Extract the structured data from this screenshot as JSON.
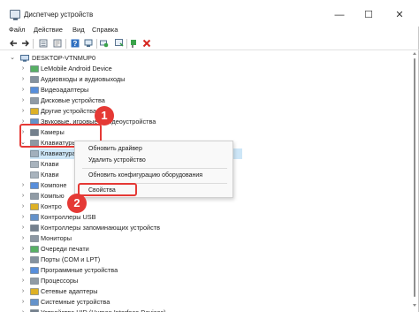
{
  "window": {
    "title": "Диспетчер устройств",
    "controls": {
      "minimize": "—",
      "maximize": "☐",
      "close": "✕"
    }
  },
  "menu": [
    "Файл",
    "Действие",
    "Вид",
    "Справка"
  ],
  "toolbar": [
    "back-icon",
    "forward-icon",
    "view-icon",
    "properties-icon",
    "help-icon",
    "computer-icon",
    "scan-hardware-icon",
    "update-driver-icon",
    "uninstall-icon"
  ],
  "tree": {
    "root": "DESKTOP-VTNMUP0",
    "categories": [
      "LeMobile Android Device",
      "Аудиовходы и аудиовыходы",
      "Видеоадаптеры",
      "Дисковые устройства",
      "Другие устройства",
      "Звуковые, игровые и видеоустройства",
      "Камеры",
      "Клавиатуры"
    ],
    "keyboards": [
      "Клавиатура HID",
      "Клави",
      "Клави"
    ],
    "after": [
      "Компоне",
      "Компью",
      "Контро",
      "Контроллеры USB",
      "Контроллеры запоминающих устройств",
      "Мониторы",
      "Очереди печати",
      "Порты (COM и LPT)",
      "Программные устройства",
      "Процессоры",
      "Сетевые адаптеры",
      "Системные устройства",
      "Устройства HID (Human Interface Devices)"
    ]
  },
  "context_menu": {
    "items": [
      "Обновить драйвер",
      "Удалить устройство",
      "Обновить конфигурацию оборудования",
      "Свойства"
    ]
  },
  "callouts": [
    "1",
    "2"
  ],
  "colors": {
    "accent": "#e53935",
    "selection": "#cde6f7"
  }
}
